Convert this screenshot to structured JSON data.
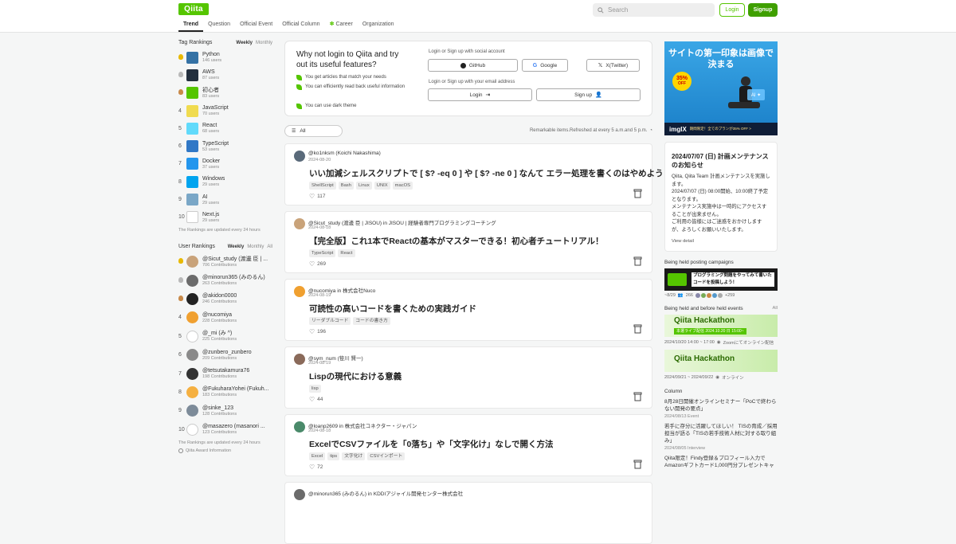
{
  "header": {
    "logo": "Qiita",
    "nav": [
      "Trend",
      "Question",
      "Official Event",
      "Official Column",
      "Career",
      "Organization"
    ],
    "search_placeholder": "Search",
    "login": "Login",
    "signup": "Signup"
  },
  "tag_rankings": {
    "title": "Tag Rankings",
    "tab_weekly": "Weekly",
    "tab_monthly": "Monthly",
    "items": [
      {
        "rank": "1",
        "name": "Python",
        "users": "146 users",
        "color": "#3572A5"
      },
      {
        "rank": "2",
        "name": "AWS",
        "users": "87 users",
        "color": "#232f3e"
      },
      {
        "rank": "3",
        "name": "初心者",
        "users": "83 users",
        "color": "#55c500"
      },
      {
        "rank": "4",
        "name": "JavaScript",
        "users": "70 users",
        "color": "#f0db4f"
      },
      {
        "rank": "5",
        "name": "React",
        "users": "68 users",
        "color": "#61dafb"
      },
      {
        "rank": "6",
        "name": "TypeScript",
        "users": "53 users",
        "color": "#3178c6"
      },
      {
        "rank": "7",
        "name": "Docker",
        "users": "37 users",
        "color": "#2496ed"
      },
      {
        "rank": "8",
        "name": "Windows",
        "users": "29 users",
        "color": "#00a4ef"
      },
      {
        "rank": "9",
        "name": "AI",
        "users": "29 users",
        "color": "#7aa7c7"
      },
      {
        "rank": "10",
        "name": "Next.js",
        "users": "29 users",
        "color": "#ffffff"
      }
    ],
    "note": "The Rankings are updated every 24 hours"
  },
  "user_rankings": {
    "title": "User Rankings",
    "tab_weekly": "Weekly",
    "tab_monthly": "Monthly",
    "tab_all": "All",
    "items": [
      {
        "rank": "1",
        "name": "@Sicut_study (渡邊 臣 | ...",
        "contrib": "706 Contributions",
        "color": "#c9a37a"
      },
      {
        "rank": "2",
        "name": "@minorun365 (みのるん)",
        "contrib": "263 Contributions",
        "color": "#6b6b6b"
      },
      {
        "rank": "3",
        "name": "@akidon0000",
        "contrib": "246 Contributions",
        "color": "#222222"
      },
      {
        "rank": "4",
        "name": "@nucomiya",
        "contrib": "228 Contributions",
        "color": "#f0a030"
      },
      {
        "rank": "5",
        "name": "@_mi (み ^)",
        "contrib": "225 Contributions",
        "color": "#ffffff"
      },
      {
        "rank": "6",
        "name": "@zunbero_zunbero",
        "contrib": "209 Contributions",
        "color": "#8a8a8a"
      },
      {
        "rank": "7",
        "name": "@tetsutakamura76",
        "contrib": "198 Contributions",
        "color": "#333333"
      },
      {
        "rank": "8",
        "name": "@FukuharaYohei (Fukuh...",
        "contrib": "183 Contributions",
        "color": "#f5b041"
      },
      {
        "rank": "9",
        "name": "@sinke_123",
        "contrib": "128 Contributions",
        "color": "#7d8b99"
      },
      {
        "rank": "10",
        "name": "@masazero (masanori ...",
        "contrib": "123 Contributions",
        "color": "#ffffff"
      }
    ],
    "note": "The Rankings are updated every 24 hours",
    "award": "Qiita Award Information"
  },
  "promo": {
    "title": "Why not login to Qiita and try out its useful features?",
    "features": [
      "You get articles that match your needs",
      "You can efficiently read back useful information",
      "You can use dark theme"
    ],
    "social_label": "Login or Sign up with social account",
    "github": "GitHub",
    "google": "Google",
    "x": "X(Twitter)",
    "email_label": "Login or Sign up with your email address",
    "login": "Login",
    "signup": "Sign up"
  },
  "filter": {
    "all": "All",
    "remark": "Remarkable items.Refreshed at every 5 a.m.and 5 p.m."
  },
  "articles": [
    {
      "user": "@ko1nksm (Koichi Nakashima)",
      "date": "2024-08-20",
      "title": "いい加減シェルスクリプトで [ $? -eq 0 ] や [ $? -ne 0 ] なんて エラー処理を書くのはやめよう！",
      "tags": [
        "ShellScript",
        "Bash",
        "Linux",
        "UNIX",
        "macOS"
      ],
      "likes": "117",
      "color": "#5a6a7a"
    },
    {
      "user": "@Sicut_study (渡邊 臣 | JISOU) in JISOU | 経験者専門プログラミングコーチング",
      "date": "2024-08-18",
      "title": "【完全版】これ1本でReactの基本がマスターできる！初心者チュートリアル！",
      "tags": [
        "TypeScript",
        "React"
      ],
      "likes": "269",
      "color": "#c9a37a"
    },
    {
      "user": "@nucomiya in 株式会社Nuco",
      "date": "2024-08-19",
      "title": "可読性の高いコードを書くための実践ガイド",
      "tags": [
        "リーダブルコード",
        "コードの書き方"
      ],
      "likes": "196",
      "color": "#f0a030"
    },
    {
      "user": "@sym_num (笹川 賢一)",
      "date": "2024-08-19",
      "title": "Lispの現代における意義",
      "tags": [
        "lisp"
      ],
      "likes": "44",
      "color": "#8a6a5a"
    },
    {
      "user": "@loanp2609 in 株式会社コネクター・ジャパン",
      "date": "2024-08-18",
      "title": "ExcelでCSVファイルを「0落ち」や「文字化け」なしで開く方法",
      "tags": [
        "Excel",
        "tips",
        "文字化け",
        "CSVインポート"
      ],
      "likes": "72",
      "color": "#4a8a6a"
    },
    {
      "user": "@minorun365 (みのるん) in KDDIアジャイル開発センター株式会社",
      "date": "",
      "title": "",
      "tags": [],
      "likes": "",
      "color": "#6b6b6b"
    }
  ],
  "ad": {
    "headline": "サイトの第一印象は画像で決まる",
    "discount": "35%",
    "off": "OFF",
    "brand": "imgIX",
    "tagline": "期間限定！全てのプランが35% OFF >"
  },
  "maintenance": {
    "title": "2024/07/07 (日) 計画メンテナンスのお知らせ",
    "body1": "Qiita, Qiita Team 計画メンテナンスを実施します。",
    "body2": "2024/07/07 (日) 08:00開始、10:00終了予定となります。",
    "body3": "メンテナンス実施中は一時的にアクセスすることが出来ません。",
    "body4": "ご利用の皆様にはご迷惑をおかけしますが、よろしくお願いいたします。",
    "view": "View detail"
  },
  "campaigns": {
    "title": "Being held posting campaigns",
    "banner": "プログラミング問題をやってみて書いたコードを投稿しよう！",
    "deadline": "~8/29",
    "count": "266",
    "extra": "+259"
  },
  "events": {
    "title": "Being held and before held events",
    "all": "All",
    "items": [
      {
        "banner": "Qiita Hackathon",
        "sub": "本選ライブ配信 2024.10.20 日 15:00~",
        "date": "2024/10/20 14:00 ~ 17:00",
        "place": "Zoomにてオンライン配信"
      },
      {
        "banner": "Qiita Hackathon",
        "sub": "",
        "date": "2024/09/21 ~ 2024/09/22",
        "place": "オンライン"
      }
    ]
  },
  "column": {
    "title": "Column",
    "items": [
      {
        "title": "8月28日開催オンラインセミナー「PoCで終わらない開発の要点」",
        "meta": "2024/08/13 Event"
      },
      {
        "title": "若手に存分に活躍してほしい！ TISの育成／採用担当が語る「TISの若手技術人材に対する取り組み」",
        "meta": "2024/08/05 Interview"
      },
      {
        "title": "Qiita限定！Findy登録＆プロフィール入力でAmazonギフトカード1,000円分プレゼントキャ",
        "meta": ""
      }
    ]
  }
}
